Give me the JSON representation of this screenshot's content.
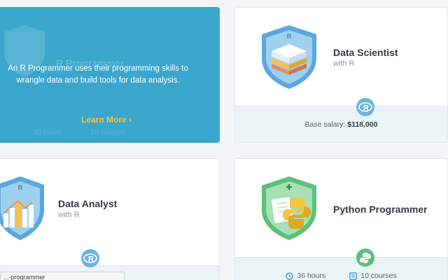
{
  "cards": {
    "r_programmer": {
      "title": "R Programmer",
      "description": "An R Programmer uses their programming skills to wrangle data and build tools for data analysis.",
      "cta": "Learn More",
      "cta_icon": "chevron-right-icon",
      "hours": "40 hours",
      "courses": "10 courses"
    },
    "data_scientist": {
      "title": "Data Scientist",
      "subtitle": "with R",
      "salary_label": "Base salary:",
      "salary_value": "$118,000",
      "tech_icon": "r-logo-icon"
    },
    "data_analyst": {
      "title": "Data Analyst",
      "subtitle": "with R",
      "tech_icon": "r-logo-icon"
    },
    "python_programmer": {
      "title": "Python Programmer",
      "hours": "36 hours",
      "courses": "10 courses",
      "tech_icon": "python-logo-icon"
    }
  },
  "status_bar": {
    "url": "...-programmer"
  },
  "colors": {
    "hover_card": "#3ba6cc",
    "cta": "#f6c342",
    "badge_blue": "#5aa7de",
    "badge_green": "#5cc07a",
    "footer_bg": "#eaf3f6"
  }
}
